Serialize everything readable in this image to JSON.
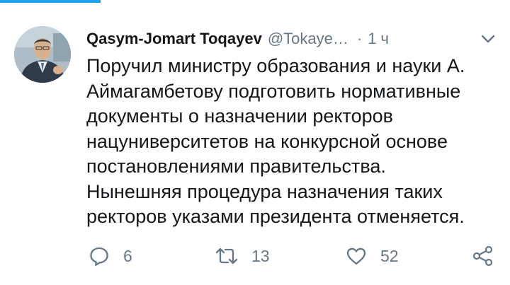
{
  "tweet": {
    "author_name": "Qasym-Jomart Toqayev",
    "author_handle": "@Tokaye…",
    "separator": "·",
    "time": "1 ч",
    "text_lines": [
      "Поручил министру образования и науки А.",
      "Аймагамбетову подготовить нормативные",
      "документы о назначении ректоров",
      "нацуниверситетов на конкурсной основе",
      "постановлениями правительства.",
      "Нынешняя процедура назначения таких",
      "ректоров указами президента отменяется."
    ]
  },
  "actions": {
    "reply_count": "6",
    "retweet_count": "13",
    "like_count": "52"
  },
  "icons": {
    "more": "chevron-down-icon",
    "reply": "reply-bubble-icon",
    "retweet": "retweet-icon",
    "like": "heart-icon",
    "share": "share-icon"
  },
  "colors": {
    "accent": "#1da1f2",
    "text": "#14171a",
    "secondary_text": "#657786"
  }
}
